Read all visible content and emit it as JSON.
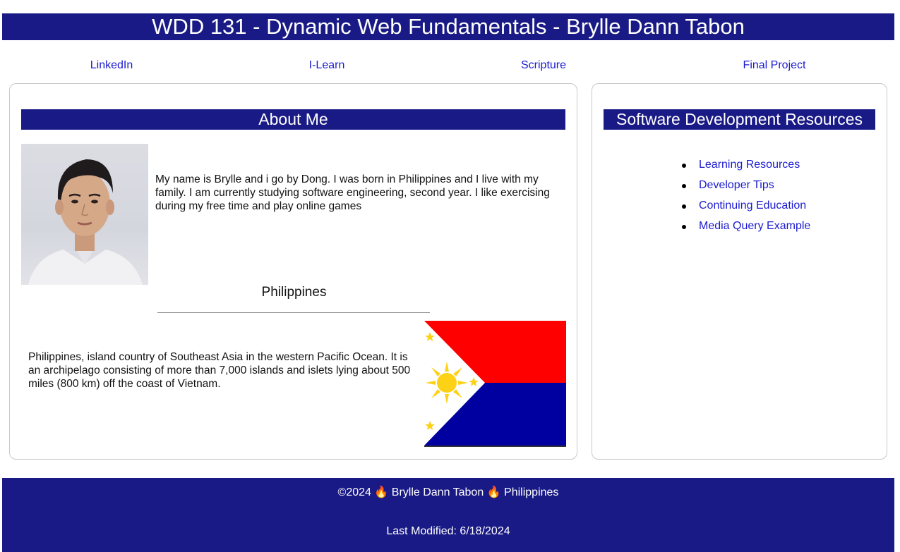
{
  "header": {
    "title": "WDD 131 - Dynamic Web Fundamentals - Brylle Dann Tabon"
  },
  "nav": {
    "items": [
      {
        "label": "LinkedIn"
      },
      {
        "label": "I-Learn"
      },
      {
        "label": "Scripture"
      },
      {
        "label": "Final Project"
      }
    ]
  },
  "about": {
    "title": "About Me",
    "bio": "My name is Brylle and i go by Dong. I was born in Philippines and I live with my family. I am currently studying software engineering, second year. I like exercising during my free time and play online games",
    "country_title": "Philippines",
    "country_description": "Philippines, island country of Southeast Asia in the western Pacific Ocean. It is an archipelago consisting of more than 7,000 islands and islets lying about 500 miles (800 km) off the coast of Vietnam."
  },
  "resources": {
    "title": "Software Development Resources",
    "items": [
      {
        "label": "Learning Resources"
      },
      {
        "label": "Developer Tips"
      },
      {
        "label": "Continuing Education"
      },
      {
        "label": "Media Query Example"
      }
    ]
  },
  "footer": {
    "copyright": "©2024",
    "name": "Brylle Dann Tabon",
    "country": "Philippines",
    "separator_icon": "fire-icon",
    "last_modified": "Last Modified: 6/18/2024"
  },
  "colors": {
    "brand": "#191a85",
    "link": "#1b1bd0",
    "flag_red": "#ff0000",
    "flag_blue": "#0000a0",
    "flag_yellow": "#fcd116"
  }
}
